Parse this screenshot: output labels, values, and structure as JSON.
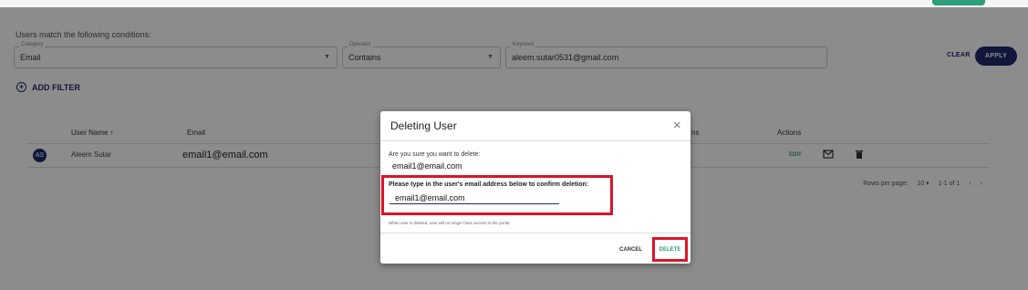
{
  "filter": {
    "heading": "Users match the following conditions:",
    "category": {
      "label": "Category",
      "value": "Email"
    },
    "operator": {
      "label": "Operator",
      "value": "Contains"
    },
    "keyword": {
      "label": "Keyword",
      "value": "aleem.sutar0531@gmail.com"
    },
    "clear_label": "CLEAR",
    "apply_label": "APPLY",
    "add_filter_label": "ADD FILTER"
  },
  "table": {
    "columns": [
      "User Name ↑",
      "Email",
      "ns",
      "Actions"
    ],
    "rows": [
      {
        "initials": "AS",
        "name": "Aleem Sutar",
        "email": "email1@email.com",
        "edit_label": "EDIT"
      }
    ],
    "pagination": {
      "rows_per_page_label": "Rows per page:",
      "rows_per_page": "10",
      "range": "1-1 of 1"
    }
  },
  "modal": {
    "title": "Deleting User",
    "question": "Are you sure you want to delete:",
    "email": "email1@email.com",
    "instruction": "Please type in the user's email address below to confirm deletion:",
    "input_value": "email1@email.com",
    "notice": "When user is deleted, user will no longer have access to the portal.",
    "cancel_label": "CANCEL",
    "delete_label": "DELETE"
  },
  "colors": {
    "primary": "#1f2a6b",
    "accent": "#2e9d7a",
    "highlight": "#d9152b"
  },
  "icons": [
    "plus-circle-icon",
    "sort-asc-icon",
    "mail-icon",
    "trash-icon",
    "close-icon",
    "chevron-down-icon",
    "chevron-left-icon",
    "chevron-right-icon"
  ]
}
